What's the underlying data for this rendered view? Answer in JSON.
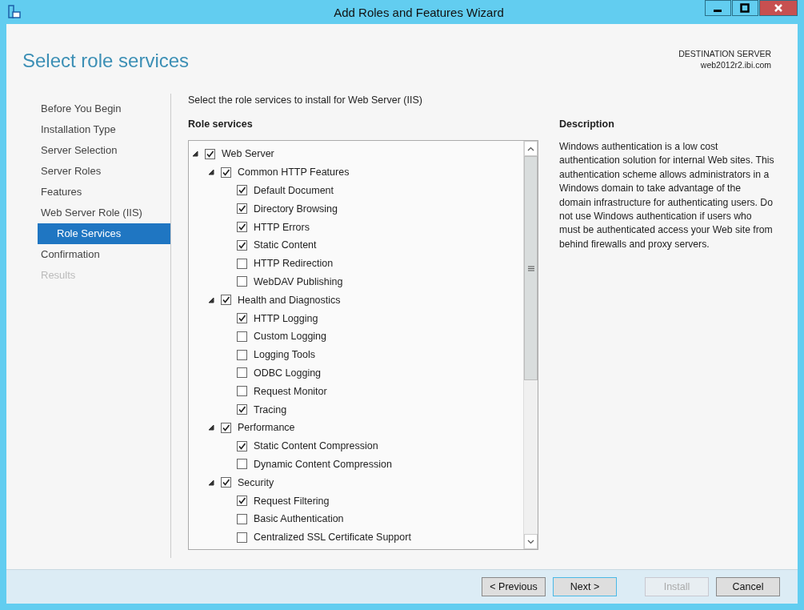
{
  "window": {
    "title": "Add Roles and Features Wizard"
  },
  "page_title": "Select role services",
  "destination": {
    "label": "DESTINATION SERVER",
    "server": "web2012r2.ibi.com"
  },
  "nav": [
    {
      "label": "Before You Begin",
      "selected": false,
      "disabled": false
    },
    {
      "label": "Installation Type",
      "selected": false,
      "disabled": false
    },
    {
      "label": "Server Selection",
      "selected": false,
      "disabled": false
    },
    {
      "label": "Server Roles",
      "selected": false,
      "disabled": false
    },
    {
      "label": "Features",
      "selected": false,
      "disabled": false
    },
    {
      "label": "Web Server Role (IIS)",
      "selected": false,
      "disabled": false,
      "children": [
        {
          "label": "Role Services",
          "selected": true,
          "disabled": false
        }
      ]
    },
    {
      "label": "Confirmation",
      "selected": false,
      "disabled": false
    },
    {
      "label": "Results",
      "selected": false,
      "disabled": true
    }
  ],
  "instruction": "Select the role services to install for Web Server (IIS)",
  "role_services": {
    "heading": "Role services",
    "tree": [
      {
        "label": "Web Server",
        "checked": true,
        "expanded": true,
        "children": [
          {
            "label": "Common HTTP Features",
            "checked": true,
            "expanded": true,
            "children": [
              {
                "label": "Default Document",
                "checked": true
              },
              {
                "label": "Directory Browsing",
                "checked": true
              },
              {
                "label": "HTTP Errors",
                "checked": true
              },
              {
                "label": "Static Content",
                "checked": true
              },
              {
                "label": "HTTP Redirection",
                "checked": false
              },
              {
                "label": "WebDAV Publishing",
                "checked": false
              }
            ]
          },
          {
            "label": "Health and Diagnostics",
            "checked": true,
            "expanded": true,
            "children": [
              {
                "label": "HTTP Logging",
                "checked": true
              },
              {
                "label": "Custom Logging",
                "checked": false
              },
              {
                "label": "Logging Tools",
                "checked": false
              },
              {
                "label": "ODBC Logging",
                "checked": false
              },
              {
                "label": "Request Monitor",
                "checked": false
              },
              {
                "label": "Tracing",
                "checked": true
              }
            ]
          },
          {
            "label": "Performance",
            "checked": true,
            "expanded": true,
            "children": [
              {
                "label": "Static Content Compression",
                "checked": true
              },
              {
                "label": "Dynamic Content Compression",
                "checked": false
              }
            ]
          },
          {
            "label": "Security",
            "checked": true,
            "expanded": true,
            "children": [
              {
                "label": "Request Filtering",
                "checked": true
              },
              {
                "label": "Basic Authentication",
                "checked": false
              },
              {
                "label": "Centralized SSL Certificate Support",
                "checked": false
              }
            ]
          }
        ]
      }
    ]
  },
  "description": {
    "heading": "Description",
    "text": "Windows authentication is a low cost authentication solution for internal Web sites. This authentication scheme allows administrators in a Windows domain to take advantage of the domain infrastructure for authenticating users. Do not use Windows authentication if users who must be authenticated access your Web site from behind firewalls and proxy servers."
  },
  "buttons": [
    {
      "label": "< Previous",
      "disabled": false,
      "focused": false
    },
    {
      "label": "Next >",
      "disabled": false,
      "focused": true
    },
    {
      "label": "Install",
      "disabled": true,
      "focused": false
    },
    {
      "label": "Cancel",
      "disabled": false,
      "focused": false
    }
  ]
}
